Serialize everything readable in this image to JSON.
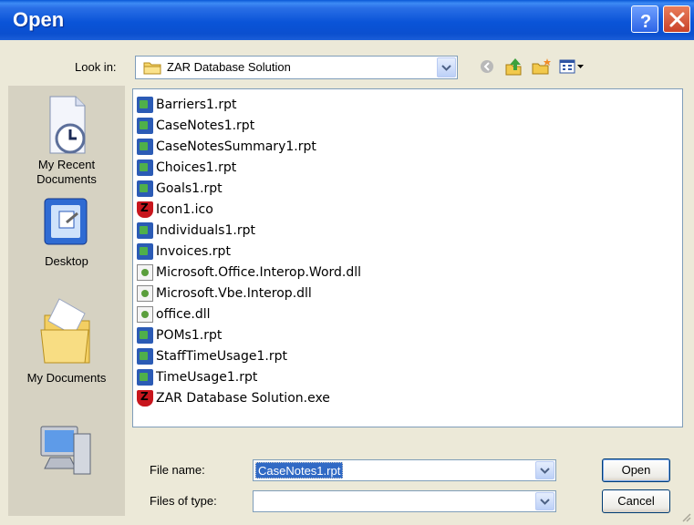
{
  "window": {
    "title": "Open"
  },
  "look_in": {
    "label": "Look in:",
    "value": "ZAR Database Solution"
  },
  "toolbar": {
    "icons": [
      "back-icon",
      "up-folder-icon",
      "new-folder-icon",
      "views-menu-icon"
    ]
  },
  "places": [
    {
      "label_line1": "My Recent",
      "label_line2": "Documents",
      "icon": "recent-documents-icon"
    },
    {
      "label_line1": "Desktop",
      "label_line2": "",
      "icon": "desktop-icon"
    },
    {
      "label_line1": "My Documents",
      "label_line2": "",
      "icon": "my-documents-icon"
    },
    {
      "label_line1": "",
      "label_line2": "",
      "icon": "my-computer-icon"
    }
  ],
  "files": [
    {
      "name": "Barriers1.rpt",
      "type": "rpt"
    },
    {
      "name": "CaseNotes1.rpt",
      "type": "rpt"
    },
    {
      "name": "CaseNotesSummary1.rpt",
      "type": "rpt"
    },
    {
      "name": "Choices1.rpt",
      "type": "rpt"
    },
    {
      "name": "Goals1.rpt",
      "type": "rpt"
    },
    {
      "name": "Icon1.ico",
      "type": "ico"
    },
    {
      "name": "Individuals1.rpt",
      "type": "rpt"
    },
    {
      "name": "Invoices.rpt",
      "type": "rpt"
    },
    {
      "name": "Microsoft.Office.Interop.Word.dll",
      "type": "dll"
    },
    {
      "name": "Microsoft.Vbe.Interop.dll",
      "type": "dll"
    },
    {
      "name": "office.dll",
      "type": "dll"
    },
    {
      "name": "POMs1.rpt",
      "type": "rpt"
    },
    {
      "name": "StaffTimeUsage1.rpt",
      "type": "rpt"
    },
    {
      "name": "TimeUsage1.rpt",
      "type": "rpt"
    },
    {
      "name": "ZAR Database Solution.exe",
      "type": "exe"
    }
  ],
  "file_name": {
    "label": "File name:",
    "value": "CaseNotes1.rpt"
  },
  "files_of_type": {
    "label": "Files of type:",
    "value": ""
  },
  "buttons": {
    "open": "Open",
    "cancel": "Cancel"
  }
}
